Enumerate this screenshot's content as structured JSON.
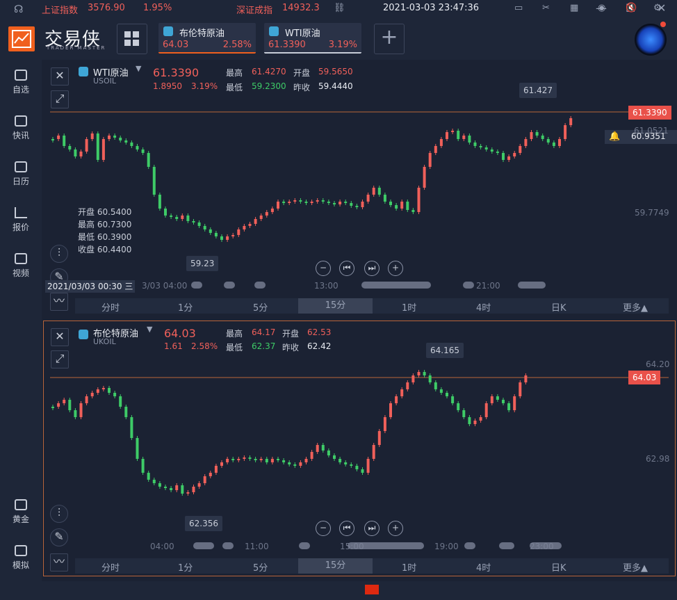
{
  "app": {
    "logo_text": "交易侠",
    "logo_sub": "TRADER MASTER",
    "window_controls": [
      "—",
      "☐",
      "✕"
    ]
  },
  "tabs": [
    {
      "name": "布伦特原油",
      "price": "64.03",
      "change": "2.58%"
    },
    {
      "name": "WTI原油",
      "price": "61.3390",
      "change": "3.19%"
    }
  ],
  "add_tab": "+",
  "sidebar": {
    "items": [
      "自选",
      "快讯",
      "日历",
      "报价",
      "视频"
    ],
    "bottom": [
      "黄金",
      "模拟"
    ]
  },
  "panel1": {
    "symbol": "WTI原油",
    "code": "USOIL",
    "price": "61.3390",
    "change": "1.8950",
    "pct": "3.19%",
    "stats": {
      "high_lbl": "最高",
      "high": "61.4270",
      "open_lbl": "开盘",
      "open": "59.5650",
      "low_lbl": "最低",
      "low": "59.2300",
      "prev_lbl": "昨收",
      "prev": "59.4440"
    },
    "ohlc": [
      "开盘 60.5400",
      "最高 60.7300",
      "最低 60.3900",
      "收盘 60.4400"
    ],
    "max_callout": "61.427",
    "min_callout": "59.23",
    "price_tag": "61.3390",
    "alert_price": "60.9351",
    "y_labels": [
      "61.0521",
      "59.7749"
    ],
    "crosshair_time": "2021/03/03 00:30 三",
    "x_labels": [
      "3/03 04:00",
      "13:00",
      "21:00"
    ],
    "nav": [
      "−",
      "⏮",
      "⏭",
      "+"
    ]
  },
  "panel2": {
    "symbol": "布伦特原油",
    "code": "UKOIL",
    "price": "64.03",
    "change": "1.61",
    "pct": "2.58%",
    "stats": {
      "high_lbl": "最高",
      "high": "64.17",
      "open_lbl": "开盘",
      "open": "62.53",
      "low_lbl": "最低",
      "low": "62.37",
      "prev_lbl": "昨收",
      "prev": "62.42"
    },
    "max_callout": "64.165",
    "min_callout": "62.356",
    "price_tag": "64.03",
    "y_labels": [
      "64.20",
      "62.98"
    ],
    "x_labels": [
      "04:00",
      "11:00",
      "15:00",
      "19:00",
      "23:00"
    ],
    "nav": [
      "−",
      "⏮",
      "⏭",
      "+"
    ]
  },
  "timeframes": [
    "分时",
    "1分",
    "5分",
    "15分",
    "1时",
    "4时",
    "日K",
    "更多▲"
  ],
  "selected_timeframe": "15分",
  "bottom": {
    "idx1_name": "上证指数",
    "idx1_val": "3576.90",
    "idx1_pct": "1.95%",
    "idx2_name": "深证成指",
    "idx2_val": "14932.3",
    "datetime": "2021-03-03 23:47:36"
  },
  "colors": {
    "up": "#f0605a",
    "down": "#3ecb67",
    "accent": "#f0601e",
    "tag": "#e9514a"
  }
}
